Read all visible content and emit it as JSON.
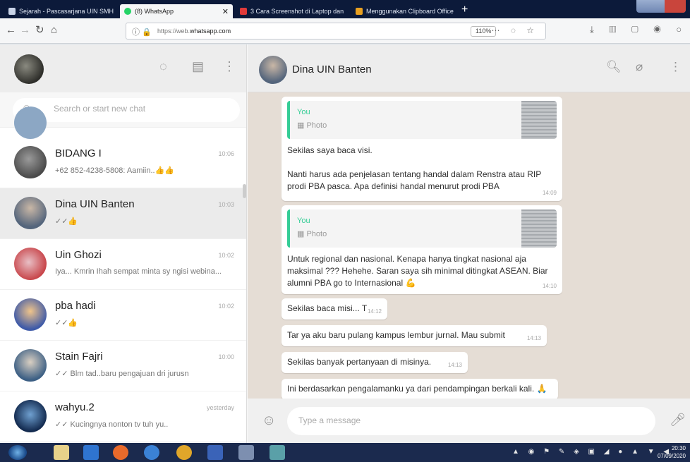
{
  "browser": {
    "tabs": [
      {
        "label": "Sejarah - Pascasarjana UIN SMH",
        "favicon": "#c9d4e8",
        "active": false
      },
      {
        "label": "(8) WhatsApp",
        "favicon": "#25d366",
        "active": true
      },
      {
        "label": "3 Cara Screenshot di Laptop dan",
        "favicon": "#e03a3a",
        "active": false
      },
      {
        "label": "Menggunakan Clipboard Office",
        "favicon": "#e8a020",
        "active": false
      }
    ],
    "url_prefix": "https://web.",
    "url_domain": "whatsapp.com",
    "zoom": "110%"
  },
  "sidebar": {
    "search_placeholder": "Search or start new chat",
    "chats": [
      {
        "name": "BIDANG I",
        "time": "10:06",
        "last": "+62 852-4238-5808: Aamiin..👍👍",
        "avatar": "#6b6b6b",
        "selected": false
      },
      {
        "name": "Dina UIN Banten",
        "time": "10:03",
        "last": "✓✓👍",
        "avatar": "#6a7d98",
        "selected": true
      },
      {
        "name": "Uin Ghozi",
        "time": "10:02",
        "last": "Iya... Kmrin Ihah sempat minta sy ngisi webina...",
        "avatar": "#cf4d4d",
        "selected": false
      },
      {
        "name": "pba hadi",
        "time": "10:02",
        "last": "✓✓👍",
        "avatar": "#4a5fa8",
        "selected": false
      },
      {
        "name": "Stain Fajri",
        "time": "10:00",
        "last": "✓✓ Blm tad..baru pengajuan dri jurusn",
        "avatar": "#5a7a9a",
        "selected": false
      },
      {
        "name": "wahyu.2",
        "time": "yesterday",
        "last": "✓✓ Kucingnya nonton tv tuh yu..",
        "avatar": "#2d4e7a",
        "selected": false
      }
    ]
  },
  "chat": {
    "contact_name": "Dina UIN Banten",
    "input_placeholder": "Type a message",
    "messages": [
      {
        "quote_author": "You",
        "quote_text": "▦ Photo",
        "line1": "Sekilas saya baca visi.",
        "line2": "Nanti harus ada penjelasan tentang handal dalam Renstra atau RIP prodi PBA pasca.  Apa definisi handal menurut prodi PBA",
        "time": "14:09"
      },
      {
        "quote_author": "You",
        "quote_text": "▦ Photo",
        "text": "Untuk regional dan nasional. Kenapa hanya tingkat nasional aja maksimal ??? Hehehe. Saran saya sih minimal ditingkat ASEAN. Biar alumni PBA go to Internasional 💪",
        "time": "14:10"
      },
      {
        "text": "Sekilas baca misi... T",
        "time": "14:12"
      },
      {
        "text": "Tar ya aku baru pulang kampus lembur jurnal. Mau submit",
        "time": "14:13"
      },
      {
        "text": "Sekilas banyak pertanyaan di misinya.",
        "time": "14:13"
      },
      {
        "text": "Ini berdasarkan pengalamanku ya dari pendampingan berkali kali. 🙏",
        "time": ""
      }
    ]
  },
  "taskbar": {
    "tray": "▲ ◉ ⚑ ✎ ◈ ▣ ◢ ● ▲ ▼ ◀",
    "time": "20:30",
    "date": "07/09/2020"
  }
}
